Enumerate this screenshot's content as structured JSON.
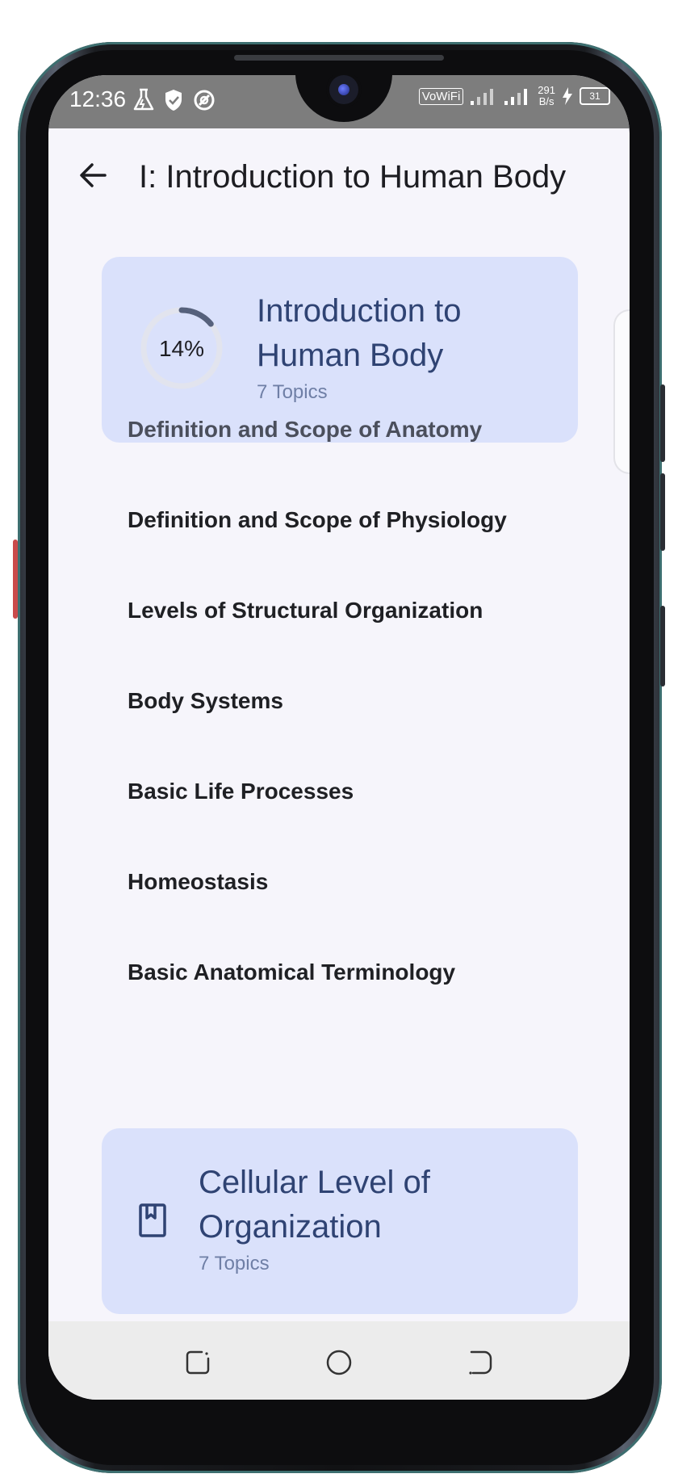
{
  "status_bar": {
    "time": "12:36",
    "vowifi": "VoWiFi",
    "net_speed_value": "291",
    "net_speed_unit": "B/s",
    "battery": "31"
  },
  "app_bar": {
    "back_icon": "arrow-left-icon",
    "title": "I: Introduction to Human Body"
  },
  "chapters": [
    {
      "title_line1": "Introduction to",
      "title_line2": "Human Body",
      "topics_count": "7 Topics",
      "progress_label": "14%",
      "progress": 0.14
    },
    {
      "title_line1": "Cellular Level of",
      "title_line2": "Organization",
      "topics_count": "7 Topics",
      "icon": "book-icon"
    }
  ],
  "topics": [
    "Definition and Scope of Anatomy",
    "Definition and Scope of Physiology",
    "Levels of Structural Organization",
    "Body Systems",
    "Basic Life Processes",
    "Homeostasis",
    "Basic Anatomical Terminology"
  ],
  "nav_bar": {
    "recents_icon": "recents-icon",
    "home_icon": "home-circle-icon",
    "back_icon": "back-gesture-icon"
  },
  "colors": {
    "card_bg": "#dae1fb",
    "card_title": "#2f4373",
    "screen_bg": "#f6f5fb",
    "status_bar_bg": "#7d7d7d"
  }
}
